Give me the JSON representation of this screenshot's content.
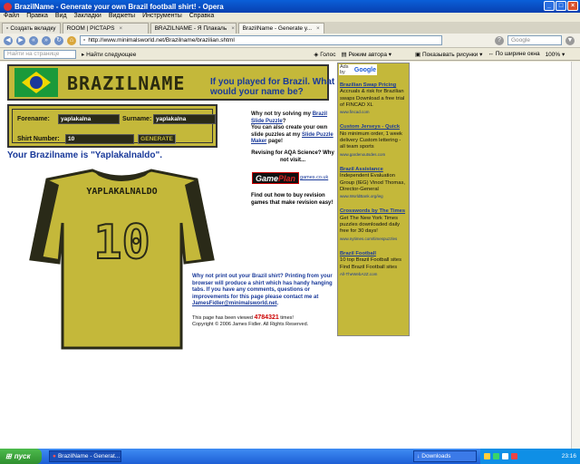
{
  "window": {
    "title": "BrazilName - Generate your own Brazil football shirt! - Opera"
  },
  "menu": [
    "Файл",
    "Правка",
    "Вид",
    "Закладки",
    "Виджеты",
    "Инструменты",
    "Справка"
  ],
  "tabs": [
    {
      "label": "Создать вкладку"
    },
    {
      "label": "ROOM | PICTAPS"
    },
    {
      "label": "BRAZILNAME - Я Плакаль"
    },
    {
      "label": "BrazilName - Generate y..."
    }
  ],
  "address": {
    "url": "http://www.minimalsworld.net/Brazilname/brazilian.shtml",
    "search_placeholder": "Google"
  },
  "toolbar2": {
    "find_placeholder": "Найти на странице",
    "find_next": "Найти следующее",
    "voice": "Голос",
    "author_mode": "Режим автора",
    "show_images": "Показывать рисунки",
    "fit_width": "По ширине окна",
    "zoom": "100%"
  },
  "page": {
    "brand": "BRAZILNAME",
    "tagline": "If you played for Brazil. What would your name be?",
    "form": {
      "forename_label": "Forename:",
      "forename_value": "yaplakalna",
      "surname_label": "Surname:",
      "surname_value": "yaplakalna",
      "shirt_label": "Shirt Number:",
      "shirt_value": "10",
      "generate": "GENERATE"
    },
    "result": "Your Brazilname is \"Yaplakalnaldo\".",
    "shirt_name": "YAPLAKALNALDO",
    "shirt_number": "10",
    "promo": {
      "q1": "Why not try solving my ",
      "q1_link": "Brazil Slide Puzzle",
      "q1_end": "?",
      "q2": "You can also create your own slide puzzles at my ",
      "q2_link": "Slide Puzzle Maker",
      "q2_end": " page!",
      "revise": "Revising for AQA Science? Why not visit...",
      "gp_logo_a": "Game",
      "gp_logo_b": "Plan",
      "gp_url": "games.co.uk",
      "find_out": "Find out how to buy revision games that make revision easy!"
    },
    "bottom": {
      "text": "Why not print out your Brazil shirt? Printing from your browser will produce a shirt which has handy hanging tabs. If you have any comments, questions or improvements for this page please contact me at ",
      "email": "JamesFidler@minimalsworld.net",
      "end": ".",
      "viewed_pre": "This page has been viewed ",
      "viewed_count": "4784321",
      "viewed_post": " times!",
      "copyright": "Copyright © 2006 James Fidler. All Rights Reserved."
    },
    "ads": {
      "label": "Ads by",
      "brand": "Google",
      "items": [
        {
          "title": "Brazilian Swap Pricing",
          "body": "Accruals & risk for Brazilian swaps Download a free trial of FINCAD XL",
          "url": "www.fincad.com"
        },
        {
          "title": "Custom Jerseys - Quick",
          "body": "No minimum order, 1 week delivery Custom lettering - all team sports",
          "url": "www.gardenoutsdes.com"
        },
        {
          "title": "Brazil Assistance",
          "body": "Independent Evaluation Group (IEG) Vinod Thomas, Director-General",
          "url": "www.WorldBank.org/ieg"
        },
        {
          "title": "Crosswords by The Times",
          "body": "Get The New York Times puzzles downloaded daily free for 30 days!",
          "url": "www.nytimes.com/timespuzzles"
        },
        {
          "title": "Brazil Football",
          "body": "10 top Brazil Football sites Find Brazil Football sites",
          "url": "All-TheWebA2Z.com"
        }
      ]
    }
  },
  "taskbar": {
    "start": "пуск",
    "task1": "BrazilName - Generat...",
    "downloads": "Downloads",
    "clock": "23:16"
  },
  "colors": {
    "shirt": "#c4b83a",
    "shirt_dark": "#2a2a18",
    "link": "#1a3a9a"
  }
}
